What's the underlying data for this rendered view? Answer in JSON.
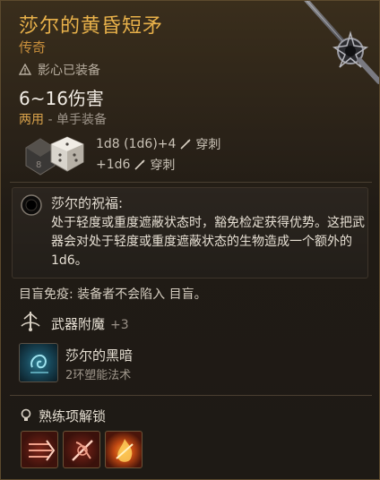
{
  "item": {
    "name": "莎尔的黄昏短矛",
    "rarity": "传奇",
    "equip_status": "影心已装备",
    "damage": "6~16伤害",
    "handedness": "两用",
    "handedness_detail": "- 单手装备",
    "damage_rolls": [
      {
        "text": "1d8 (1d6)+4",
        "type": "穿刺"
      },
      {
        "text": "+1d6",
        "type": "穿刺"
      }
    ],
    "dice_faces": [
      "8",
      "6"
    ]
  },
  "blessing": {
    "title": "莎尔的祝福:",
    "text": "处于轻度或重度遮蔽状态时，豁免检定获得优势。这把武器会对处于轻度或重度遮蔽状态的生物造成一个额外的1d6。"
  },
  "immunity": "目盲免疫: 装备者不会陷入 目盲。",
  "enchantment": {
    "label": "武器附魔",
    "bonus": "+3"
  },
  "spell": {
    "name": "莎尔的黑暗",
    "level": "2环塑能法术",
    "icon": "shadow-swirl-icon"
  },
  "proficiency": {
    "label": "熟练项解锁",
    "skills": [
      {
        "icon": "rush-attack-icon"
      },
      {
        "icon": "piercing-strike-icon"
      },
      {
        "icon": "flame-strike-icon"
      }
    ]
  },
  "colors": {
    "title": "#e8b14a",
    "rarity": "#c98f3c",
    "accent": "#d9a24b"
  }
}
